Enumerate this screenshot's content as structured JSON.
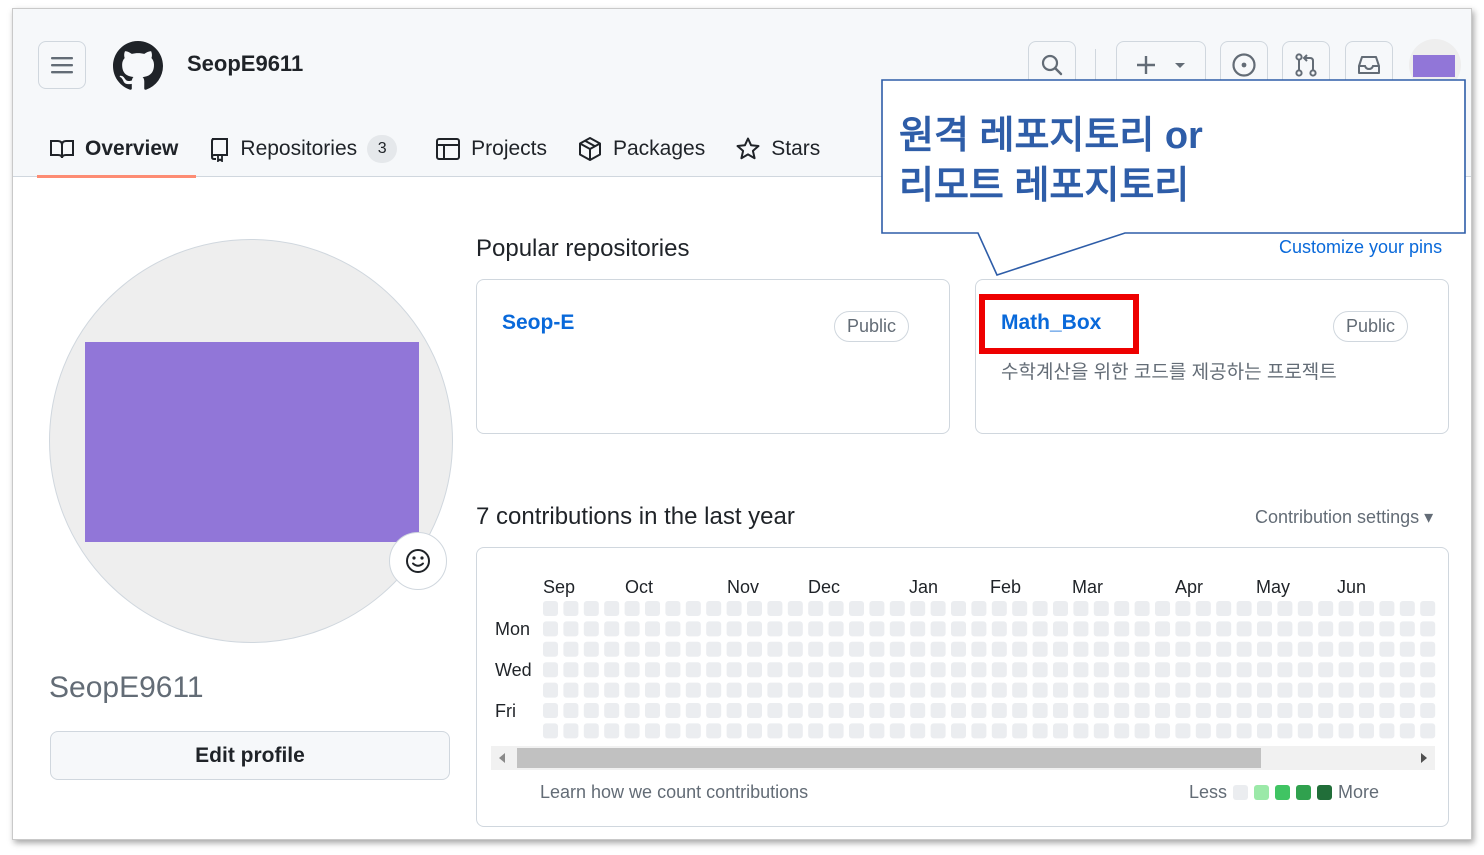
{
  "header": {
    "username": "SeopE9611",
    "tabs": [
      {
        "label": "Overview",
        "icon": "book-icon",
        "active": true
      },
      {
        "label": "Repositories",
        "icon": "repo-icon",
        "count": "3"
      },
      {
        "label": "Projects",
        "icon": "table-icon"
      },
      {
        "label": "Packages",
        "icon": "package-icon"
      },
      {
        "label": "Stars",
        "icon": "star-icon"
      }
    ],
    "icons": [
      "menu-icon",
      "github-logo-icon",
      "search-icon",
      "plus-icon",
      "issue-icon",
      "pull-request-icon",
      "inbox-icon"
    ]
  },
  "profile": {
    "name": "SeopE9611",
    "edit_label": "Edit profile",
    "avatar_color": "#9176d8"
  },
  "popular": {
    "title": "Popular repositories",
    "customize_label": "Customize your pins",
    "repos": [
      {
        "name": "Seop-E",
        "visibility": "Public",
        "description": ""
      },
      {
        "name": "Math_Box",
        "visibility": "Public",
        "description": "수학계산을 위한 코드를 제공하는 프로젝트"
      }
    ]
  },
  "contributions": {
    "title": "7 contributions in the last year",
    "settings_label": "Contribution settings ▾",
    "months": [
      "Sep",
      "Oct",
      "Nov",
      "Dec",
      "Jan",
      "Feb",
      "Mar",
      "Apr",
      "May",
      "Jun"
    ],
    "days": [
      "Mon",
      "Wed",
      "Fri"
    ],
    "learn_label": "Learn how we count contributions",
    "legend_less": "Less",
    "legend_more": "More",
    "legend_colors": [
      "#ebedf0",
      "#9be9a8",
      "#40c463",
      "#30a14e",
      "#216e39"
    ]
  },
  "callout": {
    "line1": "원격 레포지토리 or",
    "line2": "리모트 레포지토리",
    "color": "#2e5da8"
  },
  "highlight_color": "#ee0000"
}
